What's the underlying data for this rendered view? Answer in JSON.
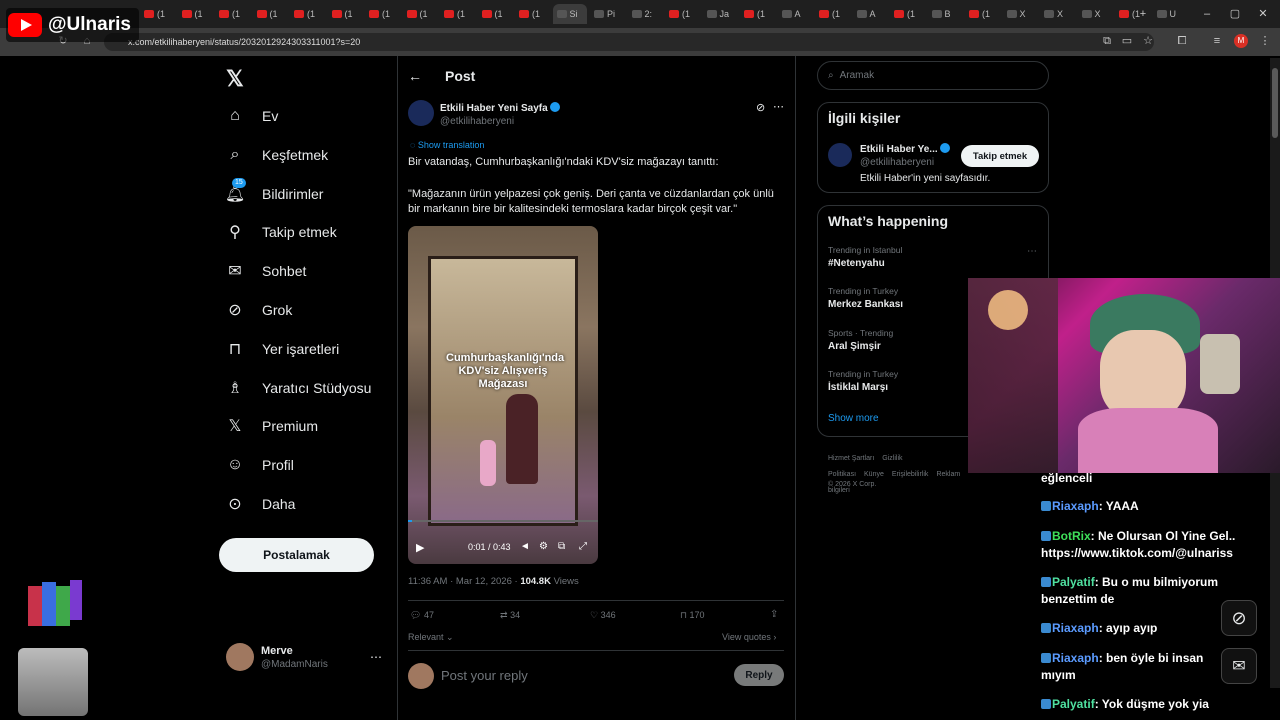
{
  "overlay": {
    "channel": "@Ulnaris"
  },
  "browser": {
    "tabs": [
      "(1",
      "(1",
      "(1",
      "(1",
      "(1",
      "(1",
      "(1",
      "(1",
      "(1",
      "(1",
      "(1",
      "Si",
      "Pi",
      "2:",
      "(1",
      "Ja",
      "(1",
      "A",
      "(1",
      "A",
      "(1",
      "B",
      "(1",
      "X",
      "X",
      "X",
      "(1",
      "U"
    ],
    "url": "x.com/etkilihaberyeni/status/2032012924303311001?s=20",
    "new_tab": "+"
  },
  "nav": {
    "items": [
      {
        "label": "Ev",
        "icon": "home-icon"
      },
      {
        "label": "Keşfetmek",
        "icon": "search-icon"
      },
      {
        "label": "Bildirimler",
        "icon": "bell-icon",
        "badge": "15"
      },
      {
        "label": "Takip etmek",
        "icon": "person-add-icon"
      },
      {
        "label": "Sohbet",
        "icon": "mail-icon"
      },
      {
        "label": "Grok",
        "icon": "grok-icon"
      },
      {
        "label": "Yer işaretleri",
        "icon": "bookmark-icon"
      },
      {
        "label": "Yaratıcı Stüdyosu",
        "icon": "studio-icon"
      },
      {
        "label": "Premium",
        "icon": "x-icon"
      },
      {
        "label": "Profil",
        "icon": "user-icon"
      },
      {
        "label": "Daha",
        "icon": "more-icon"
      }
    ],
    "post_button": "Postalamak",
    "account": {
      "name": "Merve",
      "handle": "@MadamNaris"
    }
  },
  "post": {
    "header": "Post",
    "author": "Etkili Haber Yeni Sayfa",
    "handle": "@etkilihaberyeni",
    "show_translation": "Show translation",
    "text1": "Bir vatandaş, Cumhurbaşkanlığı'ndaki KDV'siz mağazayı tanıttı:",
    "text2": "\"Mağazanın ürün yelpazesi çok geniş. Deri çanta ve cüzdanlardan çok ünlü bir markanın bire bir kalitesindeki termoslara kadar birçok çeşit var.\"",
    "video_caption": "Cumhurbaşkanlığı'nda KDV'siz Alışveriş Mağazası",
    "video_time": "0:01 / 0:43",
    "video_progress": 0.02,
    "timestamp": "11:36 AM · Mar 12, 2026 · ",
    "views_count": "104.8K",
    "views_label": " Views",
    "replies": "47",
    "reposts": "34",
    "likes": "346",
    "bookmarks": "170",
    "sort": "Relevant",
    "view_quotes": "View quotes",
    "reply_placeholder": "Post your reply",
    "reply_button": "Reply"
  },
  "right": {
    "search_placeholder": "Aramak",
    "related_title": "İlgili kişiler",
    "related": {
      "name": "Etkili Haber Ye...",
      "handle": "@etkilihaberyeni",
      "bio": "Etkili Haber'in yeni sayfasıdır.",
      "follow": "Takip etmek"
    },
    "happening_title": "What’s happening",
    "trends": [
      {
        "context": "Trending in Istanbul",
        "name": "#Netenyahu"
      },
      {
        "context": "Trending in Turkey",
        "name": "Merkez Bankası"
      },
      {
        "context": "Sports · Trending",
        "name": "Aral Şimşir"
      },
      {
        "context": "Trending in Turkey",
        "name": "İstiklal Marşı"
      }
    ],
    "show_more": "Show more",
    "footer": [
      "Hizmet Şartları",
      "Gizlilik Politikası",
      "Künye",
      "Erişilebilirlik",
      "Reklam bilgileri"
    ],
    "copyright": "© 2026 X Corp."
  },
  "chat": [
    {
      "user": "",
      "msg": "eğlenceli",
      "color": "#ffffff"
    },
    {
      "user": "Riaxaph",
      "msg": ": YAAA",
      "color": "#5b9bff"
    },
    {
      "user": "BotRix",
      "msg": ": Ne Olursan Ol Yine Gel..",
      "color": "#3ee05a",
      "extra": "https://www.tiktok.com/@ulnariss"
    },
    {
      "user": "Palyatif",
      "msg": ": Bu o mu bilmiyorum",
      "color": "#4fe0a0",
      "extra": "benzettim de"
    },
    {
      "user": "Riaxaph",
      "msg": ": ayıp ayıp",
      "color": "#5b9bff"
    },
    {
      "user": "Riaxaph",
      "msg": ": ben öyle bi insan",
      "color": "#5b9bff",
      "extra": "mıyım"
    },
    {
      "user": "Palyatif",
      "msg": ": Yok düşme yok yia",
      "color": "#4fe0a0"
    }
  ]
}
